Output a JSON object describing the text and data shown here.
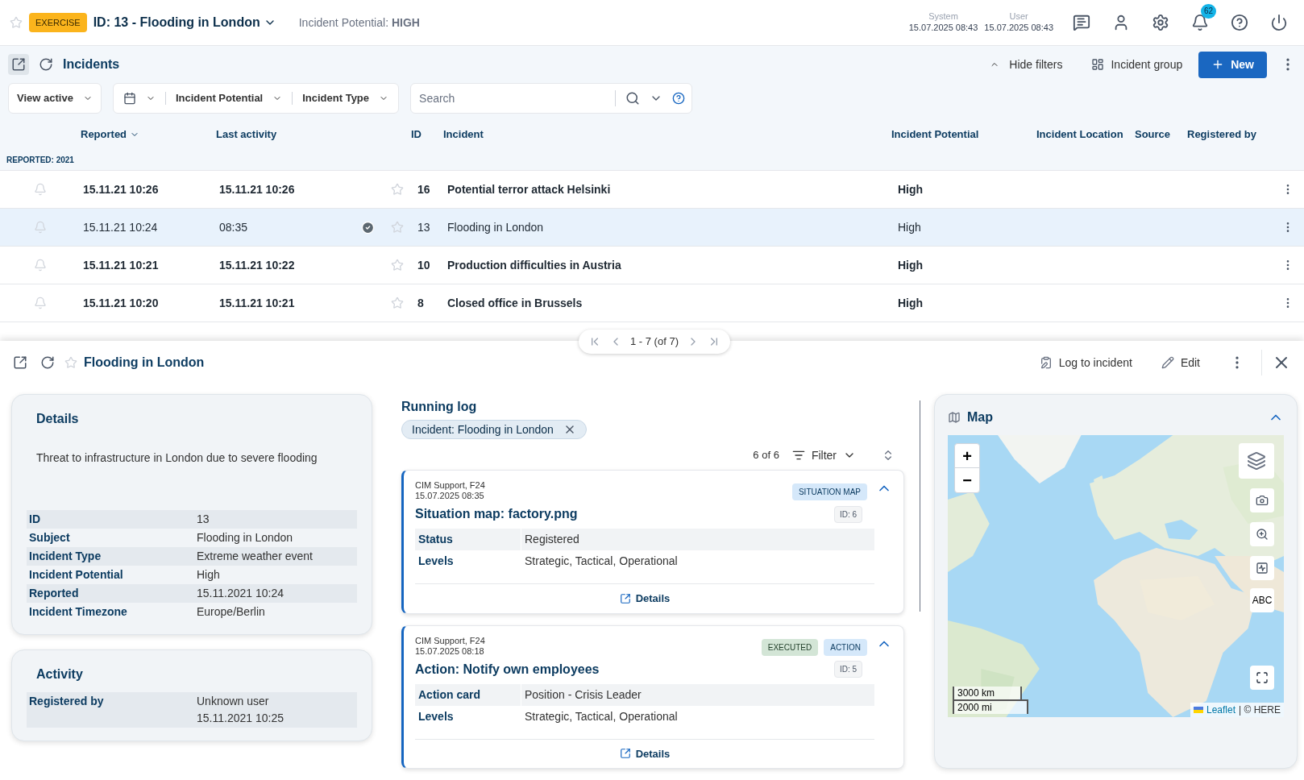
{
  "header": {
    "badge": "EXERCISE",
    "title": "ID: 13 - Flooding in London",
    "potential": "Incident Potential: **HIGH**",
    "clocks": [
      {
        "label": "System",
        "time": "15.07.2025 08:43"
      },
      {
        "label": "User",
        "time": "15.07.2025 08:43"
      }
    ],
    "notifications": "62"
  },
  "toolbar": {
    "title": "Incidents",
    "hide_filters": "Hide filters",
    "group": "Incident group",
    "new": "New"
  },
  "filters": {
    "view": "View active",
    "potential": "Incident Potential",
    "type": "Incident Type",
    "search_placeholder": "Search"
  },
  "incidents": {
    "columns": [
      "Reported",
      "Last activity",
      "ID",
      "Incident",
      "Incident Potential",
      "Incident Location",
      "Source",
      "Registered by"
    ],
    "group": "REPORTED: 2021",
    "rows": [
      {
        "reported": "15.11.21 10:26",
        "last_activity": "15.11.21 10:26",
        "done": false,
        "id": "16",
        "incident": "Potential terror attack Helsinki",
        "potential": "High",
        "unread": true,
        "selected": false
      },
      {
        "reported": "15.11.21 10:24",
        "last_activity": "08:35",
        "done": true,
        "id": "13",
        "incident": "Flooding in London",
        "potential": "High",
        "unread": false,
        "selected": true
      },
      {
        "reported": "15.11.21 10:21",
        "last_activity": "15.11.21 10:22",
        "done": false,
        "id": "10",
        "incident": "Production difficulties in Austria",
        "potential": "High",
        "unread": true,
        "selected": false
      },
      {
        "reported": "15.11.21 10:20",
        "last_activity": "15.11.21 10:21",
        "done": false,
        "id": "8",
        "incident": "Closed office in Brussels",
        "potential": "High",
        "unread": true,
        "selected": false
      }
    ],
    "pagination": "1 - 7 (of 7)"
  },
  "detail": {
    "title": "Flooding in London",
    "log_to_incident": "Log to incident",
    "edit": "Edit",
    "details": {
      "title": "Details",
      "description": "Threat to infrastructure in London due to severe flooding",
      "fields": [
        {
          "label": "ID",
          "value": "13"
        },
        {
          "label": "Subject",
          "value": "Flooding in London"
        },
        {
          "label": "Incident Type",
          "value": "Extreme weather event"
        },
        {
          "label": "Incident Potential",
          "value": "High"
        },
        {
          "label": "Reported",
          "value": "15.11.2021 10:24"
        },
        {
          "label": "Incident Timezone",
          "value": "Europe/Berlin"
        }
      ]
    },
    "activity": {
      "title": "Activity",
      "fields": [
        {
          "label": "Registered by",
          "value": "Unknown user",
          "value2": "15.11.2021 10:25"
        }
      ]
    },
    "running_log": {
      "title": "Running log",
      "chip": "Incident: Flooding in London",
      "count": "6 of 6",
      "filter": "Filter",
      "entries": [
        {
          "author": "CIM Support, F24",
          "time": "15.07.2025 08:35",
          "title": "Situation map: factory.png",
          "expanded": true,
          "tags": [
            {
              "label": "SITUATION MAP",
              "kind": "type"
            }
          ],
          "id": "ID: 6",
          "fields": [
            {
              "label": "Status",
              "value": "Registered"
            },
            {
              "label": "Levels",
              "value": "Strategic, Tactical, Operational"
            }
          ],
          "details": "Details"
        },
        {
          "author": "CIM Support, F24",
          "time": "15.07.2025 08:18",
          "title": "Action: Notify own employees",
          "expanded": true,
          "tags": [
            {
              "label": "EXECUTED",
              "kind": "status"
            },
            {
              "label": "ACTION",
              "kind": "type"
            }
          ],
          "id": "ID: 5",
          "fields": [
            {
              "label": "Action card",
              "value": "Position - Crisis Leader"
            },
            {
              "label": "Levels",
              "value": "Strategic, Tactical, Operational"
            }
          ],
          "details": "Details"
        }
      ]
    },
    "map": {
      "title": "Map",
      "expanded": true,
      "zoom_in": "+",
      "zoom_out": "−",
      "labels_button": "ABC",
      "scale": [
        "3000 km",
        "2000 mi"
      ],
      "attribution_link": "Leaflet",
      "attribution": "| © HERE"
    }
  }
}
